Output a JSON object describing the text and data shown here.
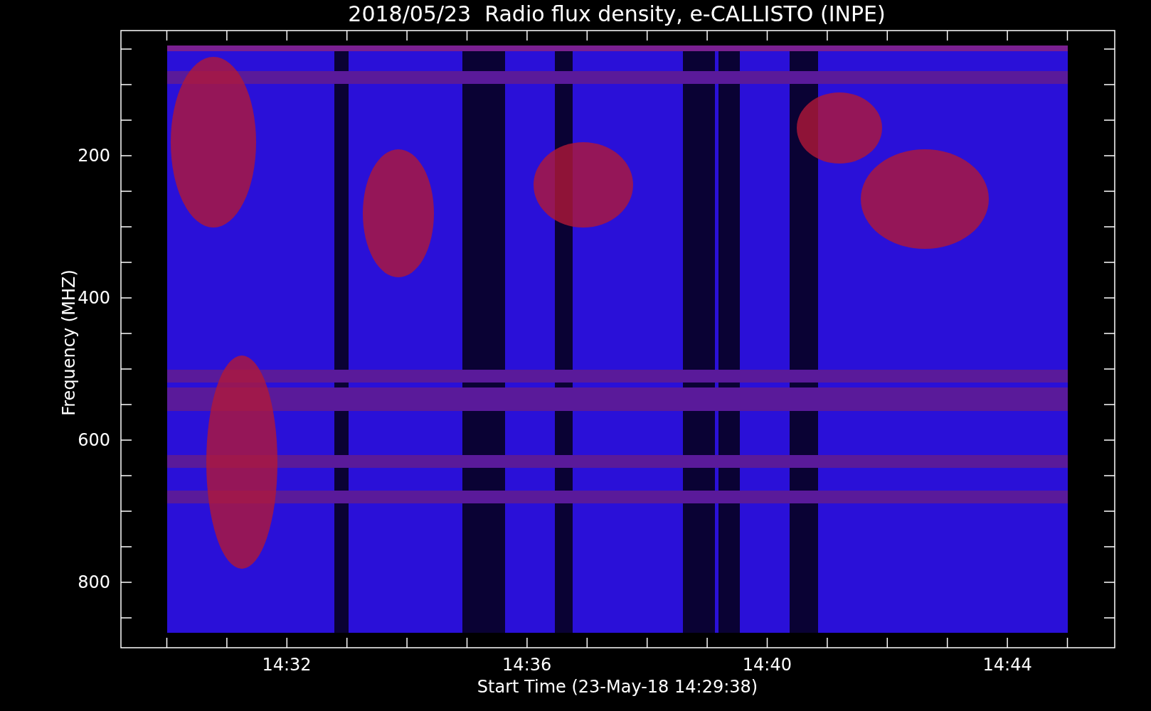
{
  "title": "2018/05/23  Radio flux density, e-CALLISTO (INPE)",
  "y_axis": {
    "label": "Frequency (MHZ)",
    "ticks": [
      "200",
      "400",
      "600",
      "800"
    ]
  },
  "x_axis": {
    "label": "Start Time (23-May-18 14:29:38)",
    "ticks": [
      "14:32",
      "14:36",
      "14:40",
      "14:44"
    ]
  }
}
